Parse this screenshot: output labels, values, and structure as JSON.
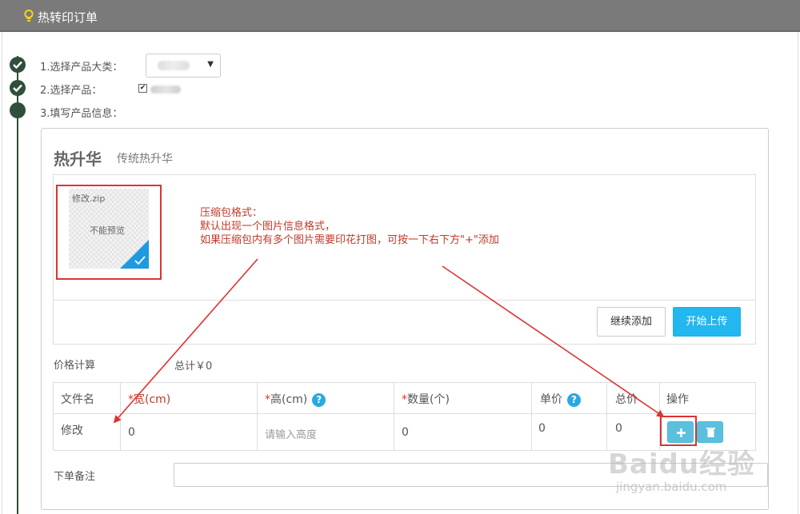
{
  "header": {
    "title": "热转印订单",
    "icon": "lightbulb-icon"
  },
  "steps": [
    {
      "label": "1.选择产品大类：",
      "status": "done"
    },
    {
      "label": "2.选择产品：",
      "status": "done"
    },
    {
      "label": "3.填写产品信息：",
      "status": "current"
    }
  ],
  "product": {
    "title": "热升华",
    "subtitle": "传统热升华"
  },
  "upload": {
    "file_name": "修改.zip",
    "preview_text": "不能预览",
    "continue_label": "继续添加",
    "start_label": "开始上传"
  },
  "annotation": {
    "text": "压缩包格式：\n默认出现一个图片信息格式，\n如果压缩包内有多个图片需要印花打图，可按一下右下方\"+\"添加",
    "color": "#c0392b"
  },
  "pricing": {
    "label": "价格计算",
    "total": "总计￥0"
  },
  "table": {
    "headers": {
      "file": "文件名",
      "width_star": "*",
      "width": "宽(cm)",
      "height_star": "*",
      "height": "高(cm)",
      "qty_star": "*",
      "qty": "数量(个)",
      "unit": "单价",
      "total": "总价",
      "ops": "操作"
    },
    "rows": [
      {
        "file": "修改",
        "width": "0",
        "height_placeholder": "请输入高度",
        "qty": "0",
        "unit": "0",
        "total": "0"
      }
    ]
  },
  "remark": {
    "label": "下单备注"
  },
  "watermark": {
    "brand": "Baidu经验",
    "url": "jingyan.baidu.com"
  },
  "colors": {
    "accent": "#22b7ee",
    "header_bg": "#7a7a7a",
    "timeline": "#2f4f3a",
    "annotation": "#d33333"
  }
}
